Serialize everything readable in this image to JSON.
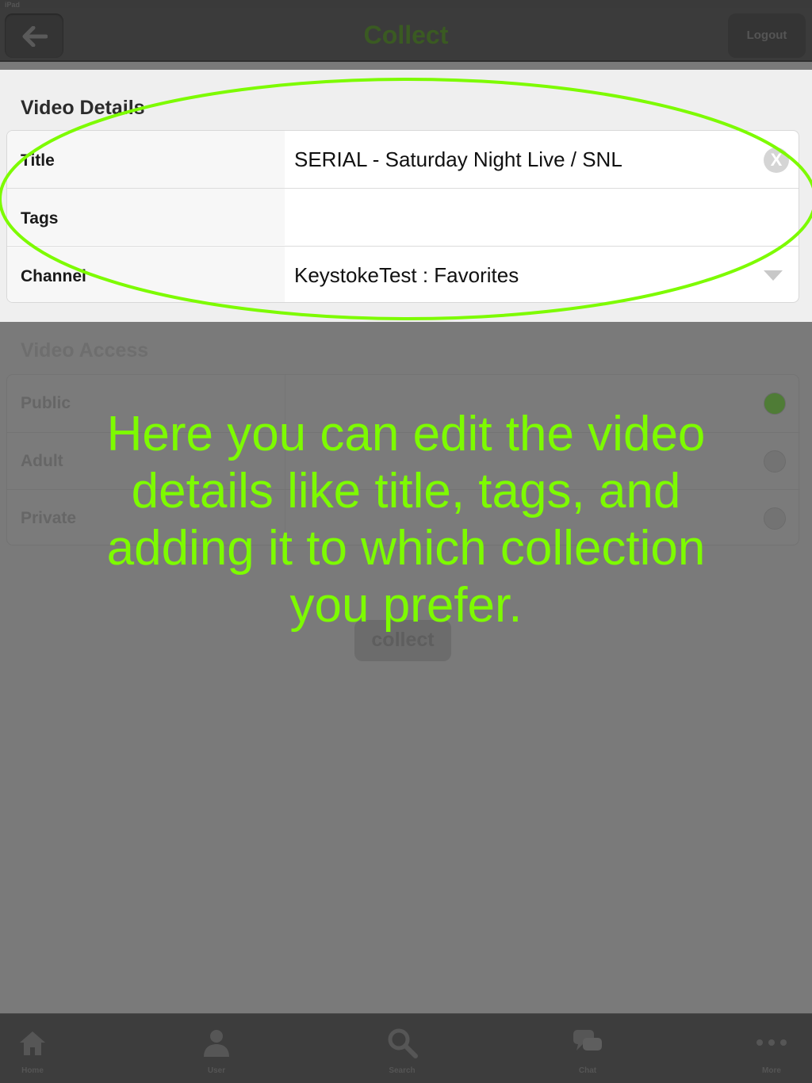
{
  "status_bar": {
    "carrier": "iPad",
    "time": "",
    "battery": ""
  },
  "nav": {
    "title": "Collect",
    "back_label": "",
    "logout_label": "Logout"
  },
  "video_details": {
    "section_title": "Video Details",
    "rows": [
      {
        "label": "Title",
        "value": "SERIAL - Saturday Night Live / SNL"
      },
      {
        "label": "Tags",
        "value": ""
      },
      {
        "label": "Channel",
        "value": "KeystokeTest : Favorites"
      }
    ],
    "clear_glyph": "X"
  },
  "video_access": {
    "section_title": "Video Access",
    "rows": [
      {
        "label": "Public",
        "selected": true
      },
      {
        "label": "Adult",
        "selected": false
      },
      {
        "label": "Private",
        "selected": false
      }
    ]
  },
  "collect_button": "collect",
  "overlay_text": "Here you can edit the video details like title, tags, and adding it to which collection you prefer.",
  "tabs": [
    {
      "label": "Home",
      "icon": "home-icon"
    },
    {
      "label": "User",
      "icon": "user-icon"
    },
    {
      "label": "Search",
      "icon": "search-icon"
    },
    {
      "label": "Chat",
      "icon": "chat-icon"
    },
    {
      "label": "More",
      "icon": "more-icon"
    }
  ],
  "colors": {
    "highlight": "#7dfb00",
    "selected_radio": "#4f7c36"
  }
}
